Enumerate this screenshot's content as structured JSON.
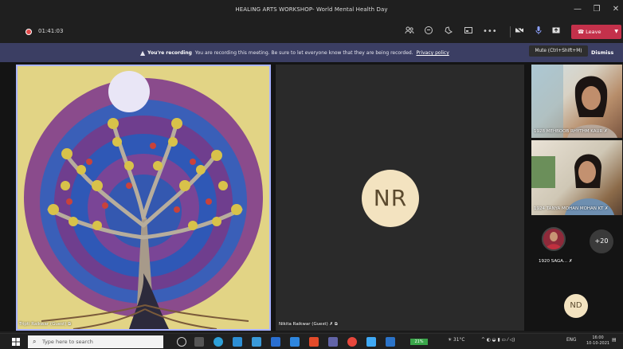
{
  "window": {
    "title": "HEALING ARTS WORKSHOP- World Mental Health Day",
    "minimize_glyph": "—",
    "maximize_glyph": "❐",
    "close_glyph": "✕"
  },
  "toolbar": {
    "timer": "01:41:03",
    "leave_label": "Leave",
    "icons": [
      "people-icon",
      "chat-icon",
      "reactions-icon",
      "share-tray-icon",
      "more-icon",
      "camera-off-icon",
      "mic-icon",
      "share-icon"
    ]
  },
  "banner": {
    "title": "You're recording",
    "message": "You are recording this meeting. Be sure to let everyone know that they are being recorded.",
    "link": "Privacy policy",
    "dismiss": "Dismiss"
  },
  "tooltip": "Mute (Ctrl+Shift+M)",
  "participants": {
    "main": "Tripti Raikwar (Guest)",
    "center": "Nikita Raikwar (Guest)",
    "center_initials": "NR",
    "side1": "1928 MEHBOOB RHYTHM KAUR",
    "side2": "1924 TANYA MOHAN MOHAN KT",
    "side3": "1920 SAGA...",
    "overflow": "+20",
    "bottom_initials": "ND"
  },
  "taskbar": {
    "search_placeholder": "Type here to search",
    "battery": "21%",
    "weather": "31°C",
    "lang": "ENG",
    "time": "16:00",
    "date": "10-10-2021"
  },
  "colors": {
    "leave": "#c4314b",
    "banner": "#3b3e63",
    "active_border": "#a9b3ff",
    "avatar_bg": "#f3e3c0"
  }
}
